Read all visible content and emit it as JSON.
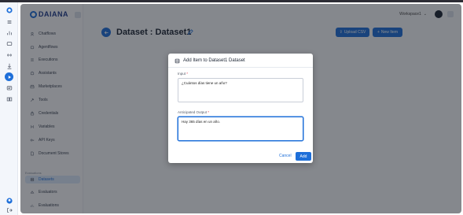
{
  "app": {
    "brand": "DAIANA",
    "workspace": "Workspace1"
  },
  "sidebar": {
    "items": [
      {
        "label": "Chatflows",
        "icon": "chat-flow-icon"
      },
      {
        "label": "Agentflows",
        "icon": "agent-icon"
      },
      {
        "label": "Executions",
        "icon": "list-icon"
      },
      {
        "label": "Assistants",
        "icon": "robot-icon"
      },
      {
        "label": "Marketplaces",
        "icon": "store-icon"
      },
      {
        "label": "Tools",
        "icon": "tool-icon"
      },
      {
        "label": "Credentials",
        "icon": "lock-icon"
      },
      {
        "label": "Variables",
        "icon": "variable-icon"
      },
      {
        "label": "API Keys",
        "icon": "key-icon"
      },
      {
        "label": "Document Stores",
        "icon": "document-icon"
      }
    ],
    "section_label": "Evaluations",
    "eval_items": [
      {
        "label": "Datasets",
        "icon": "dataset-icon"
      },
      {
        "label": "Evaluators",
        "icon": "evaluator-icon"
      },
      {
        "label": "Evaluations",
        "icon": "evaluation-icon"
      }
    ]
  },
  "page": {
    "title": "Dataset : Dataset1",
    "upload_label": "Upload CSV",
    "new_item_label": "New Item"
  },
  "modal": {
    "title": "Add Item to Dataset1 Dataset",
    "input_label": "Input",
    "input_value": "¿Cuántos días tiene un año?",
    "output_label": "Anticipated Output",
    "output_value": "Hay 365 días en un año.",
    "required_mark": "*",
    "cancel_label": "Cancel",
    "add_label": "Add"
  },
  "colors": {
    "accent": "#1e6fd9",
    "overlay": "rgba(20,24,32,0.5)"
  }
}
